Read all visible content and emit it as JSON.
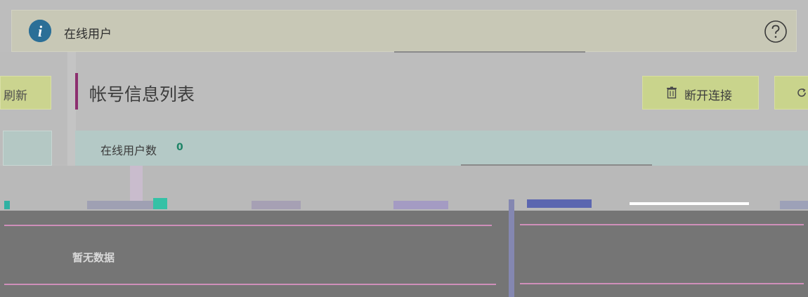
{
  "notice": {
    "title": "在线用户",
    "info_icon": "info-icon",
    "help_icon": "help-icon"
  },
  "toolbar": {
    "left_refresh_label": "刷新",
    "disconnect_label": "断开连接",
    "disconnect_icon": "trash-icon",
    "right_refresh_icon": "refresh-icon"
  },
  "panel": {
    "title": "帐号信息列表"
  },
  "summary": {
    "online_count_label": "在线用户数",
    "online_count": "0"
  },
  "table": {
    "empty_text": "暂无数据"
  },
  "colors": {
    "accent_bar": "#8c2f6f",
    "button_bg": "#c9d48c",
    "count_value": "#1e8467",
    "info_icon": "#2b6f97"
  }
}
